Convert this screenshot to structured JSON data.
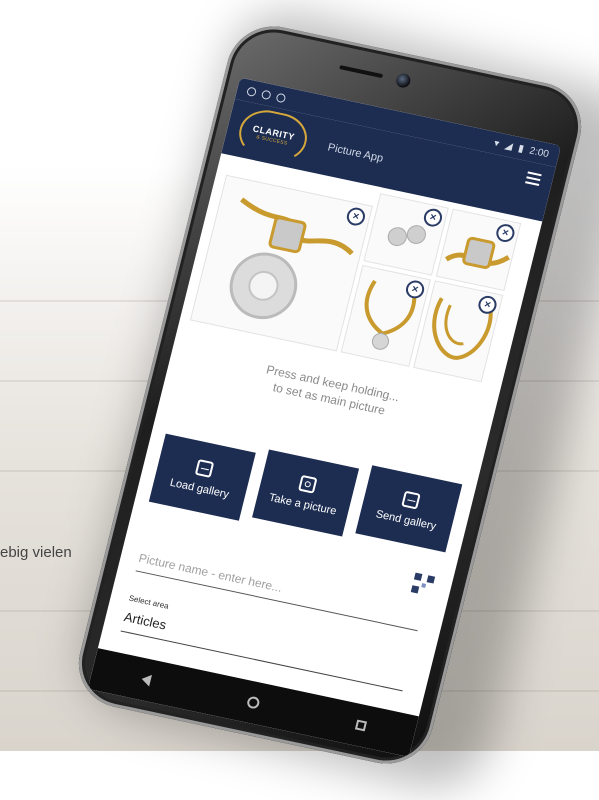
{
  "background": {
    "cropped_text": "ebig vielen"
  },
  "status": {
    "time": "2:00"
  },
  "app": {
    "logo_text": "CLARITY",
    "logo_subtext": "& SUCCESS",
    "title": "Picture App"
  },
  "gallery": {
    "remove_glyph": "×",
    "hint_line1": "Press and keep holding...",
    "hint_line2": "to set as main picture"
  },
  "actions": {
    "load_label": "Load gallery",
    "take_label": "Take a picture",
    "send_label": "Send gallery"
  },
  "form": {
    "name_placeholder": "Picture name - enter here...",
    "area_label": "Select area",
    "area_value": "Articles"
  },
  "colors": {
    "primary": "#1d2d52",
    "gold": "#d6a73b"
  }
}
